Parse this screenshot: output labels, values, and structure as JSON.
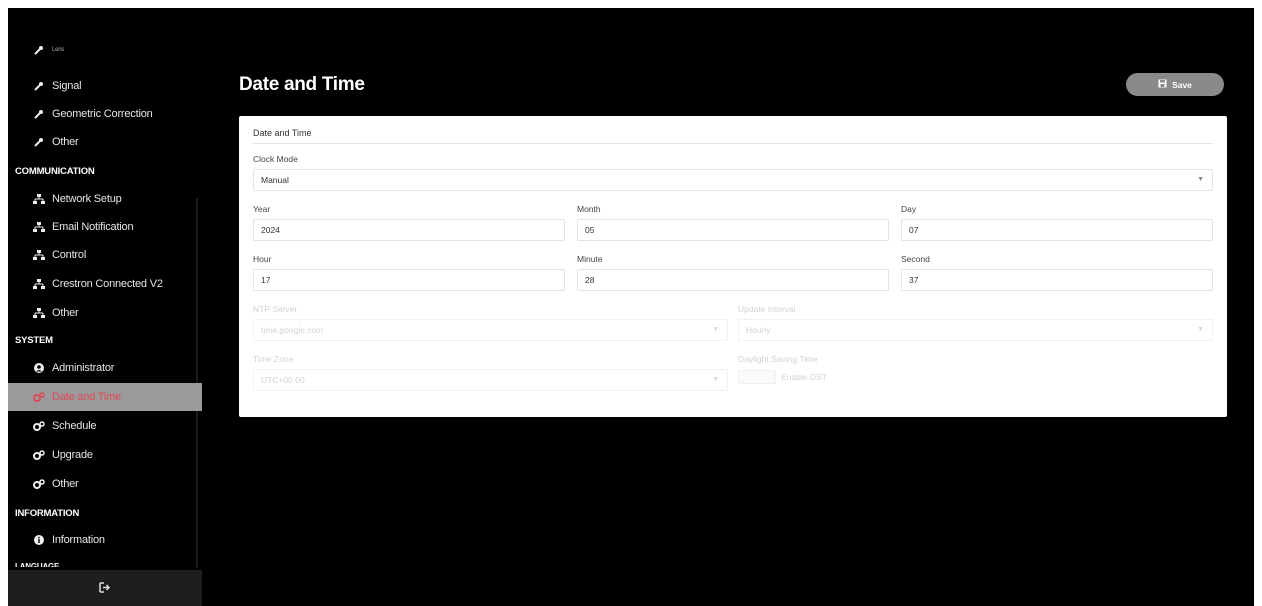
{
  "sidebar": {
    "top_items": [
      {
        "label": "Lens",
        "icon": "wrench-icon"
      },
      {
        "label": "Signal",
        "icon": "wrench-icon"
      },
      {
        "label": "Geometric Correction",
        "icon": "wrench-icon"
      },
      {
        "label": "Other",
        "icon": "wrench-icon"
      }
    ],
    "communication_header": "COMMUNICATION",
    "communication_items": [
      {
        "label": "Network Setup",
        "icon": "network-icon"
      },
      {
        "label": "Email Notification",
        "icon": "network-icon"
      },
      {
        "label": "Control",
        "icon": "network-icon"
      },
      {
        "label": "Crestron Connected V2",
        "icon": "network-icon"
      },
      {
        "label": "Other",
        "icon": "network-icon"
      }
    ],
    "system_header": "SYSTEM",
    "system_items": [
      {
        "label": "Administrator",
        "icon": "user-circle-icon"
      },
      {
        "label": "Date and Time",
        "icon": "gears-icon",
        "active": true
      },
      {
        "label": "Schedule",
        "icon": "gears-icon"
      },
      {
        "label": "Upgrade",
        "icon": "gears-icon"
      },
      {
        "label": "Other",
        "icon": "gears-icon"
      }
    ],
    "information_header": "INFORMATION",
    "information_items": [
      {
        "label": "Information",
        "icon": "info-circle-icon"
      }
    ],
    "language_header": "LANGUAGE",
    "logout_icon": "logout-icon"
  },
  "main": {
    "title": "Date and Time",
    "save_label": "Save",
    "save_icon": "floppy-disk-icon"
  },
  "form": {
    "section_title": "Date and Time",
    "clock_mode": {
      "label": "Clock Mode",
      "value": "Manual"
    },
    "year": {
      "label": "Year",
      "value": "2024"
    },
    "month": {
      "label": "Month",
      "value": "05"
    },
    "day": {
      "label": "Day",
      "value": "07"
    },
    "hour": {
      "label": "Hour",
      "value": "17"
    },
    "minute": {
      "label": "Minute",
      "value": "28"
    },
    "second": {
      "label": "Second",
      "value": "37"
    },
    "ntp_server": {
      "label": "NTP Server",
      "value": "time.google.com"
    },
    "update_interval": {
      "label": "Update Interval",
      "value": "Hourly"
    },
    "time_zone": {
      "label": "Time Zone",
      "value": "UTC+00:00"
    },
    "daylight_saving": {
      "label": "Daylight Saving Time",
      "value": "Enable DST"
    }
  },
  "colors": {
    "active_accent": "#e04a57",
    "active_bg": "#9a9a9a",
    "save_bg": "#8a8a8a"
  }
}
